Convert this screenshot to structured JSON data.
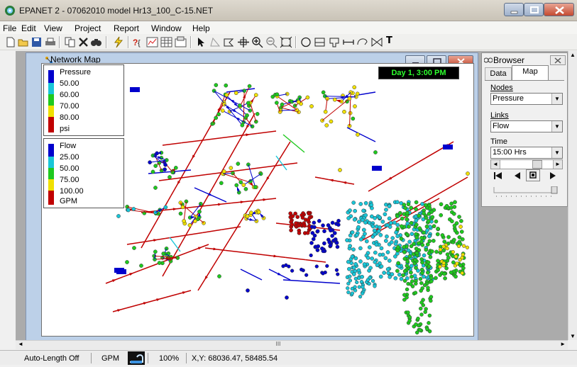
{
  "window": {
    "title": "EPANET 2 - 07062010 model Hr13_100_C-15.NET"
  },
  "menu": [
    "File",
    "Edit",
    "View",
    "Project",
    "Report",
    "Window",
    "Help"
  ],
  "toolbar": {
    "text_tool_label": "T"
  },
  "network_map": {
    "title": "Network Map",
    "day_time": "Day 1, 3:00 PM",
    "pressure_legend": {
      "title": "Pressure",
      "values": [
        "50.00",
        "60.00",
        "70.00",
        "80.00"
      ],
      "unit": "psi",
      "colors": [
        "#0000cc",
        "#19c6d8",
        "#1fc91f",
        "#f0e000",
        "#c00000"
      ]
    },
    "flow_legend": {
      "title": "Flow",
      "values": [
        "25.00",
        "50.00",
        "75.00",
        "100.00"
      ],
      "unit": "GPM",
      "colors": [
        "#0000cc",
        "#19c6d8",
        "#1fc91f",
        "#f0e000",
        "#c00000"
      ]
    }
  },
  "browser": {
    "title": "Browser",
    "tabs": [
      "Data",
      "Map"
    ],
    "active_tab": "Map",
    "nodes_label": "Nodes",
    "nodes_value": "Pressure",
    "links_label": "Links",
    "links_value": "Flow",
    "time_label": "Time",
    "time_value": "15:00 Hrs"
  },
  "scroll": {
    "h_thumb_label": "III"
  },
  "status": {
    "auto_length": "Auto-Length Off",
    "flow_units": "GPM",
    "zoom": "100%",
    "xy": "X,Y: 68036.47, 58485.54"
  }
}
